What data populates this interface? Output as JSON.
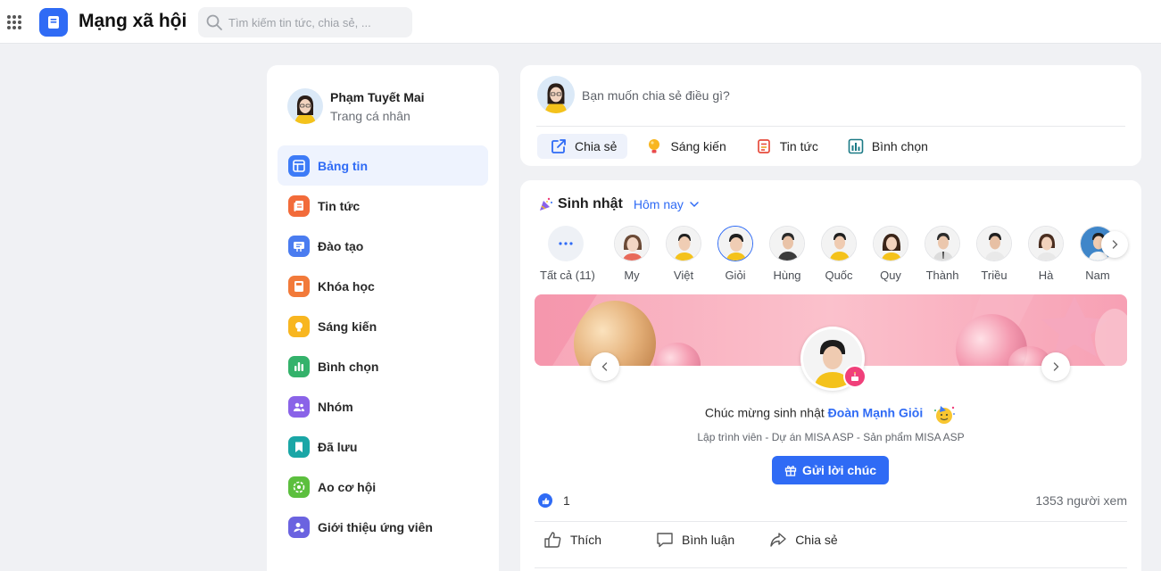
{
  "app": {
    "title": "Mạng xã hội"
  },
  "search": {
    "placeholder": "Tìm kiếm tin tức, chia sẻ, ..."
  },
  "profile": {
    "name": "Phạm Tuyết Mai",
    "subtitle": "Trang cá nhân"
  },
  "sidebar": {
    "items": [
      {
        "label": "Bảng tin",
        "icon": "newsfeed-icon",
        "color": "#3d7bf7",
        "active": true
      },
      {
        "label": "Tin tức",
        "icon": "news-icon",
        "color": "#f26b3a"
      },
      {
        "label": "Đào tạo",
        "icon": "training-icon",
        "color": "#4a7cf0"
      },
      {
        "label": "Khóa học",
        "icon": "course-icon",
        "color": "#f27a3a"
      },
      {
        "label": "Sáng kiến",
        "icon": "lightbulb-icon",
        "color": "#f8b620"
      },
      {
        "label": "Bình chọn",
        "icon": "poll-icon",
        "color": "#34b26b"
      },
      {
        "label": "Nhóm",
        "icon": "group-icon",
        "color": "#8a63e8"
      },
      {
        "label": "Đã lưu",
        "icon": "bookmark-icon",
        "color": "#1aa6a6"
      },
      {
        "label": "Ao cơ hội",
        "icon": "opportunity-icon",
        "color": "#5cbf3e"
      },
      {
        "label": "Giới thiệu ứng viên",
        "icon": "refer-candidate-icon",
        "color": "#6b63e0"
      }
    ]
  },
  "composer": {
    "prompt": "Bạn muốn chia sẻ điều gì?",
    "actions": [
      {
        "label": "Chia sẻ",
        "icon": "share-edit-icon",
        "active": true
      },
      {
        "label": "Sáng kiến",
        "icon": "lightbulb-icon"
      },
      {
        "label": "Tin tức",
        "icon": "news-icon"
      },
      {
        "label": "Bình chọn",
        "icon": "poll-icon"
      }
    ]
  },
  "birthday": {
    "title": "Sinh nhật",
    "filter": "Hôm nay",
    "people": [
      {
        "label": "Tất cả (11)"
      },
      {
        "label": "My"
      },
      {
        "label": "Việt"
      },
      {
        "label": "Giỏi",
        "selected": true
      },
      {
        "label": "Hùng"
      },
      {
        "label": "Quốc"
      },
      {
        "label": "Quy"
      },
      {
        "label": "Thành"
      },
      {
        "label": "Triều"
      },
      {
        "label": "Hà"
      },
      {
        "label": "Nam"
      }
    ],
    "greeting_prefix": "Chúc mừng sinh nhật",
    "celebrant": "Đoàn Mạnh Giỏi",
    "role": "Lập trình viên - Dự án MISA ASP - Sản phẩm MISA ASP",
    "wish_button": "Gửi lời chúc",
    "likes": "1",
    "views": "1353 người xem",
    "reactions": [
      {
        "label": "Thích",
        "icon": "thumbs-up-icon"
      },
      {
        "label": "Bình luận",
        "icon": "comment-icon"
      },
      {
        "label": "Chia sẻ",
        "icon": "share-icon"
      }
    ]
  },
  "colors": {
    "accent": "#2f6bf5",
    "background": "#f0f1f4"
  }
}
